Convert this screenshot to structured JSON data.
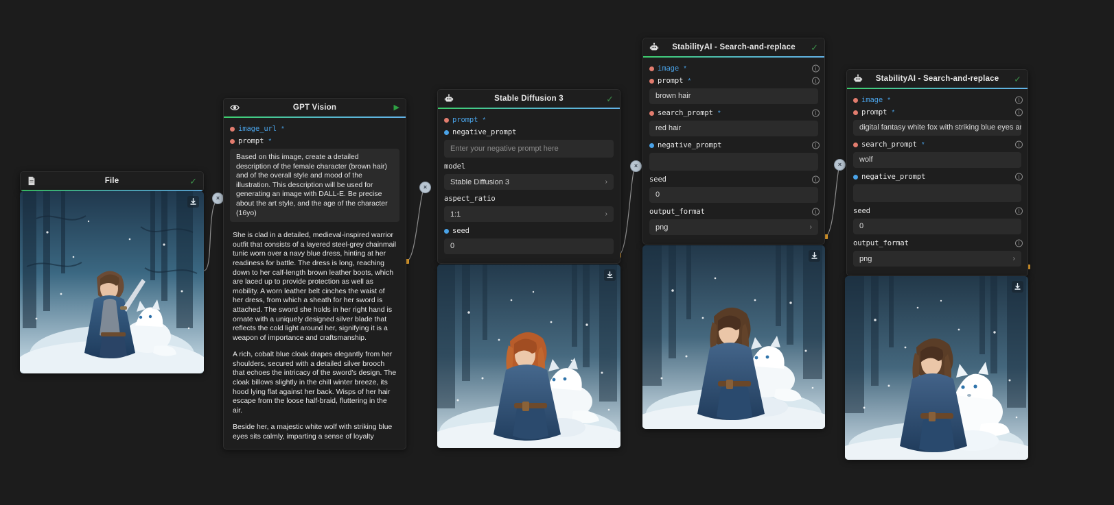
{
  "app": {
    "canvas_bg": "#1c1c1c",
    "accent_green": "#3ecf6e",
    "accent_blue": "#63b3e8",
    "required_dot": "#e27c6e",
    "optional_dot": "#4aa3e8",
    "handle": "#f0a830"
  },
  "nodes": {
    "file": {
      "title": "File",
      "icon": "file-icon",
      "status_icon": "check-icon",
      "image_alt": "snowy-forest-warrior-girl-with-white-fox",
      "download_label": "download-icon"
    },
    "gpt_vision": {
      "title": "GPT Vision",
      "icon": "eye-icon",
      "status_icon": "play-icon",
      "fields": [
        {
          "name": "image_url",
          "required": true,
          "dot": "req",
          "style": "blue"
        },
        {
          "name": "prompt",
          "required": true,
          "dot": "req",
          "style": "blue"
        }
      ],
      "prompt_value": "Based on this image, create a detailed description of the female character (brown hair) and of the overall style and mood of the illustration. This description will be used for generating an image with DALL-E. Be precise about the art style, and the age of the character (16yo)",
      "output_paragraphs": [
        "She is clad in a detailed, medieval-inspired warrior outfit that consists of a layered steel-grey chainmail tunic worn over a navy blue dress, hinting at her readiness for battle. The dress is long, reaching down to her calf-length brown leather boots, which are laced up to provide protection as well as mobility. A worn leather belt cinches the waist of her dress, from which a sheath for her sword is attached. The sword she holds in her right hand is ornate with a uniquely designed silver blade that reflects the cold light around her, signifying it is a weapon of importance and craftsmanship.",
        "A rich, cobalt blue cloak drapes elegantly from her shoulders, secured with a detailed silver brooch that echoes the intricacy of the sword's design. The cloak billows slightly in the chill winter breeze, its hood lying flat against her back. Wisps of her hair escape from the loose half-braid, fluttering in the air.",
        "Beside her, a majestic white wolf with striking blue eyes sits calmly, imparting a sense of loyalty"
      ]
    },
    "sd3": {
      "title": "Stable Diffusion 3",
      "icon": "robot-icon",
      "status_icon": "check-icon",
      "labels": {
        "prompt": "prompt",
        "negative_prompt": "negative_prompt",
        "model": "model",
        "aspect_ratio": "aspect_ratio",
        "seed": "seed"
      },
      "negative_prompt_placeholder": "Enter your negative prompt here",
      "negative_prompt_value": "",
      "model_value": "Stable Diffusion 3",
      "aspect_ratio_value": "1:1",
      "seed_value": "0",
      "image_alt": "red-haired-woman-with-white-wolf-in-snow",
      "download_label": "download-icon"
    },
    "sar1": {
      "title": "StabilityAI - Search-and-replace",
      "icon": "robot-icon",
      "status_icon": "check-icon",
      "labels": {
        "image": "image",
        "prompt": "prompt",
        "search_prompt": "search_prompt",
        "negative_prompt": "negative_prompt",
        "seed": "seed",
        "output_format": "output_format"
      },
      "prompt_value": "brown hair",
      "search_prompt_value": "red hair",
      "negative_prompt_value": "",
      "seed_value": "0",
      "output_format_value": "png",
      "info_label": "info-icon",
      "image_alt": "brown-haired-woman-with-white-wolf-in-snow",
      "download_label": "download-icon"
    },
    "sar2": {
      "title": "StabilityAI - Search-and-replace",
      "icon": "robot-icon",
      "status_icon": "check-icon",
      "labels": {
        "image": "image",
        "prompt": "prompt",
        "search_prompt": "search_prompt",
        "negative_prompt": "negative_prompt",
        "seed": "seed",
        "output_format": "output_format"
      },
      "prompt_value": "digital fantasy white fox with striking blue eyes and black fur on",
      "search_prompt_value": "wolf",
      "negative_prompt_value": "",
      "seed_value": "0",
      "output_format_value": "png",
      "info_label": "info-icon",
      "image_alt": "brown-haired-woman-with-white-fox-in-snow",
      "download_label": "download-icon"
    }
  },
  "edges": {
    "delete_glyph": "×"
  }
}
